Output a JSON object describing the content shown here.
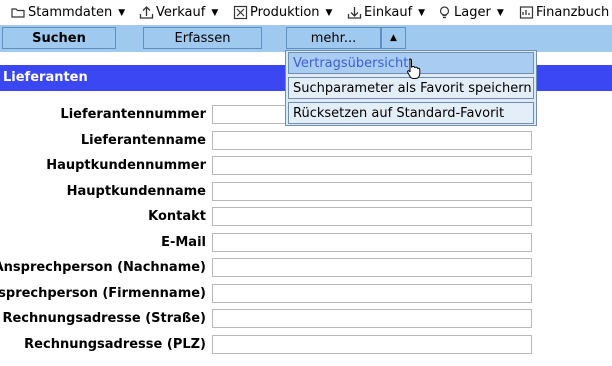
{
  "menubar": {
    "items": [
      {
        "label": "Stammdaten",
        "icon": "folder-icon"
      },
      {
        "label": "Verkauf",
        "icon": "upload-icon"
      },
      {
        "label": "Produktion",
        "icon": "production-icon"
      },
      {
        "label": "Einkauf",
        "icon": "download-icon"
      },
      {
        "label": "Lager",
        "icon": "bulb-icon"
      },
      {
        "label": "Finanzbuch",
        "icon": "ledger-icon"
      }
    ]
  },
  "toolbar": {
    "search_label": "Suchen",
    "create_label": "Erfassen",
    "more_label": "mehr...",
    "more_toggle": "▲"
  },
  "dropdown": {
    "items": [
      {
        "label": "Vertragsübersicht",
        "active": true
      },
      {
        "label": "Suchparameter als Favorit speichern",
        "active": false
      },
      {
        "label": "Rücksetzen auf Standard-Favorit",
        "active": false
      }
    ]
  },
  "section": {
    "title": "Lieferanten"
  },
  "form": {
    "fields": [
      {
        "label": "Lieferantennummer",
        "value": ""
      },
      {
        "label": "Lieferantenname",
        "value": ""
      },
      {
        "label": "Hauptkundennummer",
        "value": ""
      },
      {
        "label": "Hauptkundenname",
        "value": ""
      },
      {
        "label": "Kontakt",
        "value": ""
      },
      {
        "label": "E-Mail",
        "value": ""
      },
      {
        "label": "Ansprechperson (Nachname)",
        "value": ""
      },
      {
        "label": "Ansprechperson (Firmenname)",
        "value": ""
      },
      {
        "label": "Rechnungsadresse (Straße)",
        "value": ""
      },
      {
        "label": "Rechnungsadresse (PLZ)",
        "value": ""
      }
    ]
  },
  "colors": {
    "toolbar_bg": "#9fc9ee",
    "section_bar": "#3a47f2",
    "dropdown_active_bg": "#a9cdf2",
    "dropdown_active_text": "#3d5fd0"
  }
}
